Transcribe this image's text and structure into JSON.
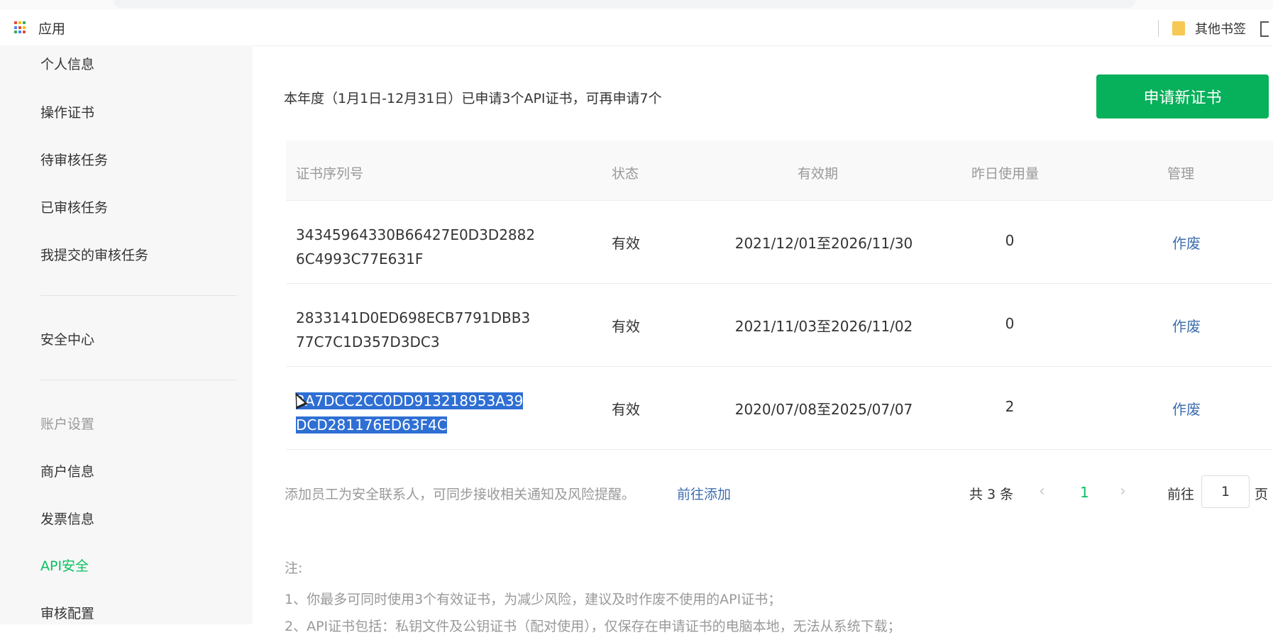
{
  "browser": {
    "apps_label": "应用",
    "other_bookmarks_label": "其他书签"
  },
  "sidebar": {
    "items_top": [
      {
        "label": "个人信息"
      },
      {
        "label": "操作证书"
      },
      {
        "label": "待审核任务"
      },
      {
        "label": "已审核任务"
      },
      {
        "label": "我提交的审核任务"
      }
    ],
    "security_center": "安全中心",
    "account_group_label": "账户设置",
    "items_account": [
      {
        "label": "商户信息"
      },
      {
        "label": "发票信息"
      },
      {
        "label": "API安全",
        "active": true
      },
      {
        "label": "审核配置"
      }
    ]
  },
  "main": {
    "summary": "本年度（1月1日-12月31日）已申请3个API证书，可再申请7个",
    "apply_button": "申请新证书",
    "table": {
      "headers": [
        "证书序列号",
        "状态",
        "有效期",
        "昨日使用量",
        "管理"
      ],
      "rows": [
        {
          "serial_1": "34345964330B66427E0D3D2882",
          "serial_2": "6C4993C77E631F",
          "status": "有效",
          "validity": "2021/12/01至2026/11/30",
          "usage": "0",
          "action": "作废"
        },
        {
          "serial_1": "2833141D0ED698ECB7791DBB3",
          "serial_2": "77C7C1D357D3DC3",
          "status": "有效",
          "validity": "2021/11/03至2026/11/02",
          "usage": "0",
          "action": "作废"
        },
        {
          "serial_1": "3A7DCC2CC0DD913218953A39",
          "serial_2": "DCD281176ED63F4C",
          "status": "有效",
          "validity": "2020/07/08至2025/07/07",
          "usage": "2",
          "action": "作废",
          "selected": true
        }
      ]
    },
    "contact_text": "添加员工为安全联系人，可同步接收相关通知及风险提醒。",
    "contact_link": "前往添加",
    "pager": {
      "total": "共 3 条",
      "prev": "‹",
      "current_page": "1",
      "next": "›",
      "goto_label": "前往",
      "goto_value": "1",
      "unit": "页"
    },
    "notes": {
      "title": "注:",
      "items": [
        "1、你最多可同时使用3个有效证书，为减少风险，建议及时作废不使用的API证书；",
        "2、API证书包括：私钥文件及公钥证书（配对使用），仅保存在申请证书的电脑本地，无法从系统下载；"
      ]
    }
  },
  "colors": {
    "brand_green": "#07c160",
    "button_green": "#07b05a",
    "link_blue": "#3d6db0",
    "selection_blue": "#2f6fd4"
  }
}
